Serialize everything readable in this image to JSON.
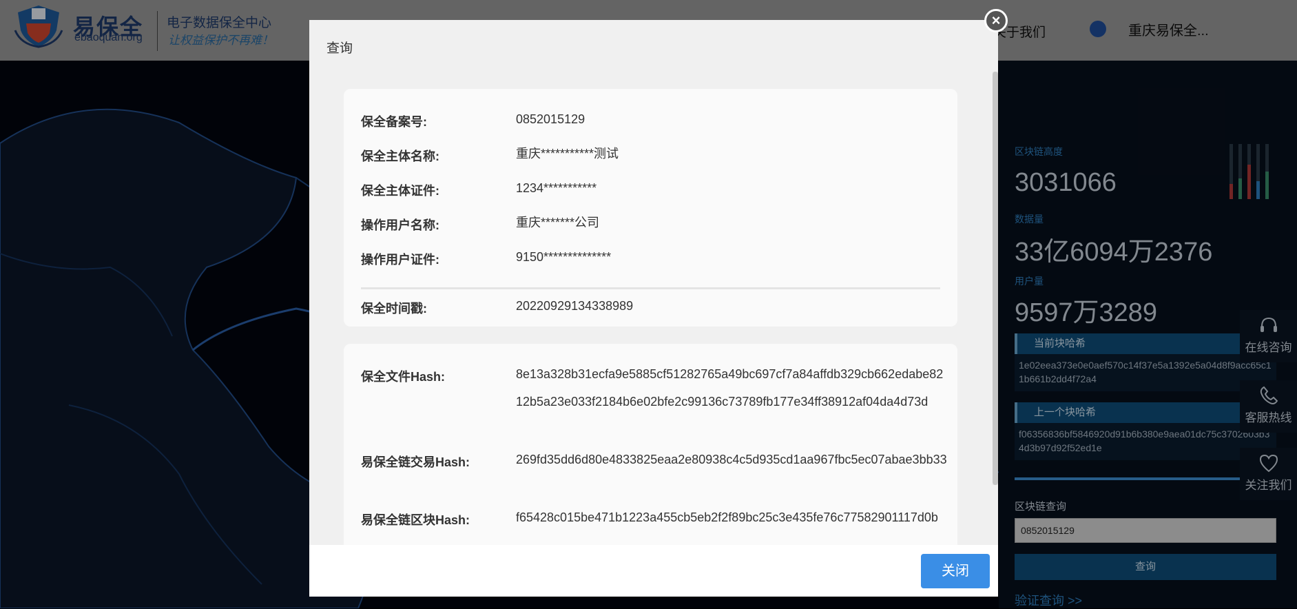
{
  "header": {
    "brand_cn": "易保全",
    "brand_en": "ebaoquan.org",
    "tagline": "电子数据保全中心",
    "slogan": "让权益保护不再难！",
    "nav_about": "关于我们",
    "user_name": "重庆易保全..."
  },
  "stats": {
    "block_height_label": "区块链高度",
    "block_height_value": "3031066",
    "data_count_label": "数据量",
    "data_count_value": "33亿6094万2376",
    "user_count_label": "用户量",
    "user_count_value": "9597万3289"
  },
  "current_block": {
    "title": "当前块哈希",
    "hash": "1e02eea373e0e0aef570c14f37e5a1392e5a04d8f9acc65c11b661b2dd4f72a4"
  },
  "previous_block": {
    "title": "上一个块哈希",
    "hash": "f06356836bf5846920d91b6b380e9aea01dc75c3702603b34d3b97d92f52ed1e"
  },
  "block_query": {
    "label": "区块链查询",
    "input_value": "0852015129",
    "button_label": "查询",
    "verify_link": "验证查询 >>"
  },
  "floating": {
    "consult": "在线咨询",
    "hotline": "客服热线",
    "follow": "关注我们"
  },
  "modal": {
    "title": "查询",
    "close_label": "关闭",
    "info": [
      {
        "label": "保全备案号:",
        "value": "0852015129"
      },
      {
        "label": "保全主体名称:",
        "value": "重庆***********测试"
      },
      {
        "label": "保全主体证件:",
        "value": "1234***********"
      },
      {
        "label": "操作用户名称:",
        "value": "重庆*******公司"
      },
      {
        "label": "操作用户证件:",
        "value": "9150**************"
      }
    ],
    "timestamp": {
      "label": "保全时间戳:",
      "value": "20220929134338989"
    },
    "hashes": [
      {
        "label": "保全文件Hash:",
        "value": "8e13a328b31ecfa9e5885cf51282765a49bc697cf7a84affdb329cb662edabe8212b5a23e033f2184b6e02bfe2c99136c73789fb177e34ff38912af04da4d73d"
      },
      {
        "label": "易保全链交易Hash:",
        "value": "269fd35dd6d80e4833825eaa2e80938c4c5d935cd1aa967fbc5ec07abae3bb33"
      },
      {
        "label": "易保全链区块Hash:",
        "value": "f65428c015be471b1223a455cb5eb2f2f89bc25c3e435fe76c77582901117d0b"
      }
    ]
  },
  "colors": {
    "accent": "#3a8ee6",
    "panel_blue": "#0e4d7a",
    "stat_label": "#2f7fbf"
  }
}
